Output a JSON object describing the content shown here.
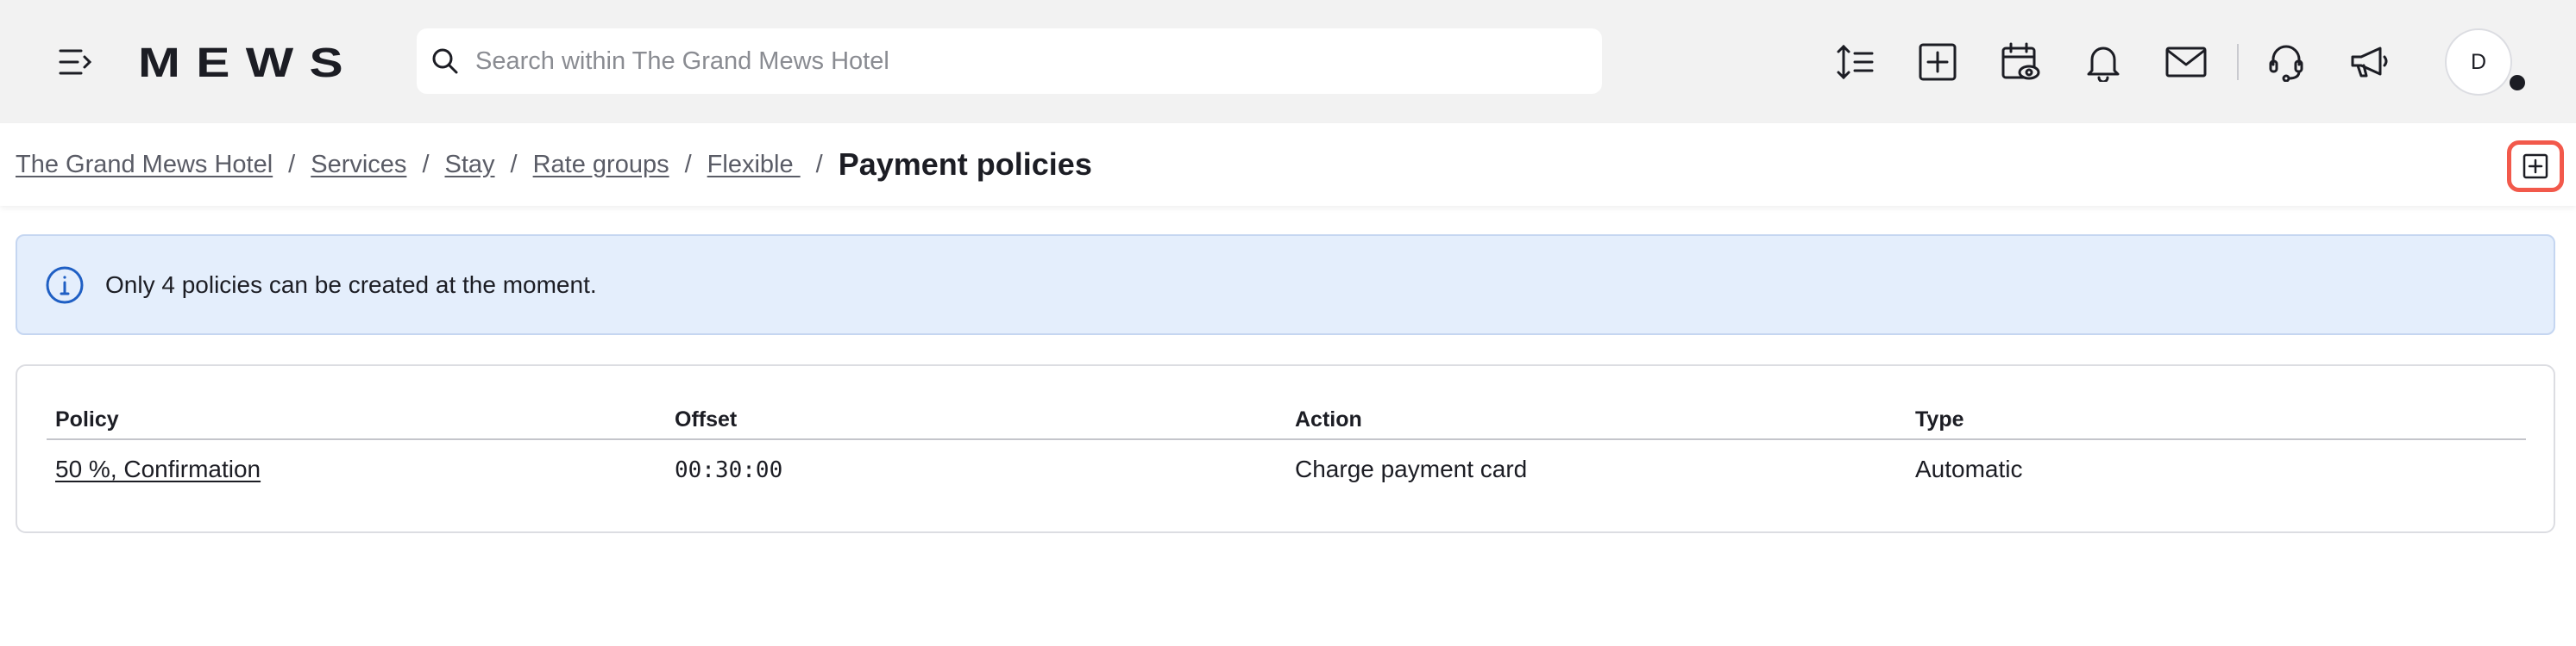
{
  "header": {
    "logo_text": "MEWS",
    "search": {
      "placeholder": "Search within The Grand Mews Hotel",
      "value": ""
    },
    "icons": [
      "menu-collapse-icon",
      "line-spacing-icon",
      "add-square-icon",
      "calendar-view-icon",
      "bell-icon",
      "mail-icon",
      "headset-icon",
      "megaphone-icon"
    ],
    "avatar_initial": "D"
  },
  "breadcrumb": {
    "items": [
      "The Grand Mews Hotel",
      "Services",
      "Stay",
      "Rate groups",
      "Flexible "
    ],
    "separator": "/",
    "current": "Payment policies"
  },
  "info_banner": {
    "text": "Only 4 policies can be created at the moment."
  },
  "table": {
    "columns": [
      "Policy",
      "Offset",
      "Action",
      "Type"
    ],
    "rows": [
      [
        "50 %, Confirmation",
        "00:30:00",
        "Charge payment card",
        "Automatic"
      ]
    ]
  },
  "colors": {
    "topbar_bg": "#f2f2f2",
    "info_bg": "#e4eefc",
    "info_icon": "#1f5fc4",
    "highlight": "#f2594b",
    "text": "#1c1d24"
  }
}
